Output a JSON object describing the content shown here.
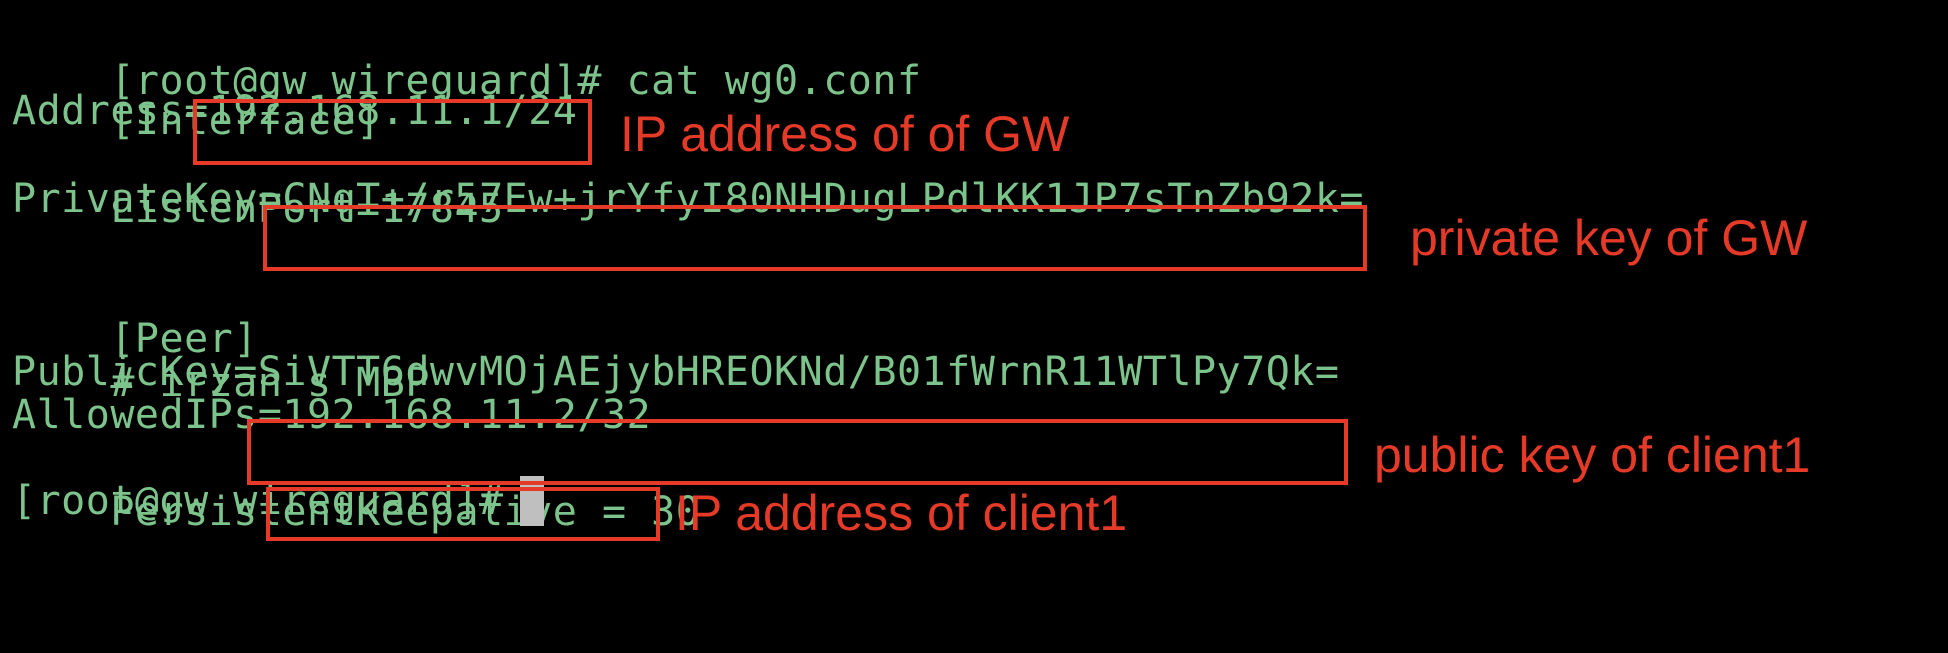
{
  "terminal": {
    "lines": {
      "cmd": "[root@gw wireguard]# cat wg0.conf",
      "interface_header": "[Interface]",
      "address_key": "Address=",
      "address_value": "192.168.11.1/24",
      "listen_port": "ListenPort=17845",
      "private_key_key": "PrivateKey=",
      "private_key_value": "CNqT+/r57Ew+jrYfyI80NHDugLPdlKK1JP7sTnZb92k=",
      "peer_header": "[Peer]",
      "comment": "# irzan's MBP",
      "public_key_key": "PublicKey=",
      "public_key_value": "SiVTT6dwvMOjAEjybHREOKNd/B01fWrnR11WTlPy7Qk=",
      "allowed_ips_key": "AllowedIPs=",
      "allowed_ips_value": "192.168.11.2/32",
      "keepalive": "PersistentKeepalive = 30",
      "prompt": "[root@gw wireguard]#"
    },
    "colors": {
      "background": "#000000",
      "text": "#7cc48b",
      "annotation": "#e53a28",
      "cursor": "#bfbfbf"
    }
  },
  "annotations": {
    "gw_ip": "IP address of of GW",
    "gw_private_key": "private key of GW",
    "client_public_key": "public key of client1",
    "client_ip": "IP address of client1"
  }
}
